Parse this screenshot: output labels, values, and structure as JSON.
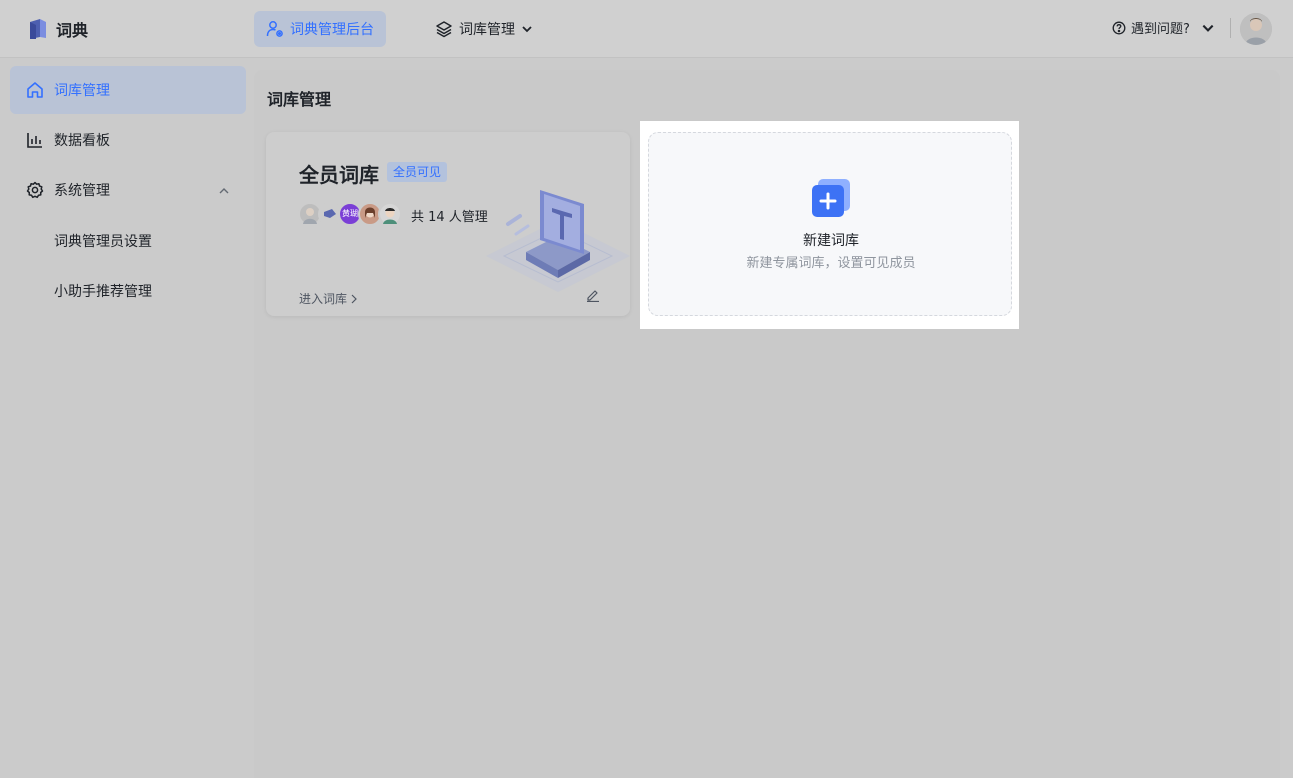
{
  "app": {
    "title": "词典"
  },
  "topbar": {
    "admin_label": "词典管理后台",
    "library_label": "词库管理",
    "help_label": "遇到问题?"
  },
  "sidebar": {
    "items": [
      {
        "label": "词库管理",
        "icon": "home-icon",
        "active": true
      },
      {
        "label": "数据看板",
        "icon": "bar-chart-icon",
        "active": false
      },
      {
        "label": "系统管理",
        "icon": "gear-icon",
        "active": false
      }
    ],
    "sub_items": [
      {
        "label": "词典管理员设置"
      },
      {
        "label": "小助手推荐管理"
      }
    ]
  },
  "main": {
    "page_title": "词库管理",
    "library_card": {
      "title": "全员词库",
      "badge": "全员可见",
      "avatar_text": "黄瑚",
      "manager_count": "共 14 人管理",
      "enter_label": "进入词库"
    },
    "new_card": {
      "title": "新建词库",
      "subtitle": "新建专属词库，设置可见成员"
    }
  },
  "colors": {
    "accent": "#3370ff",
    "active_bg": "#b9c3d6",
    "avatar_purple": "#7b3fd6"
  }
}
